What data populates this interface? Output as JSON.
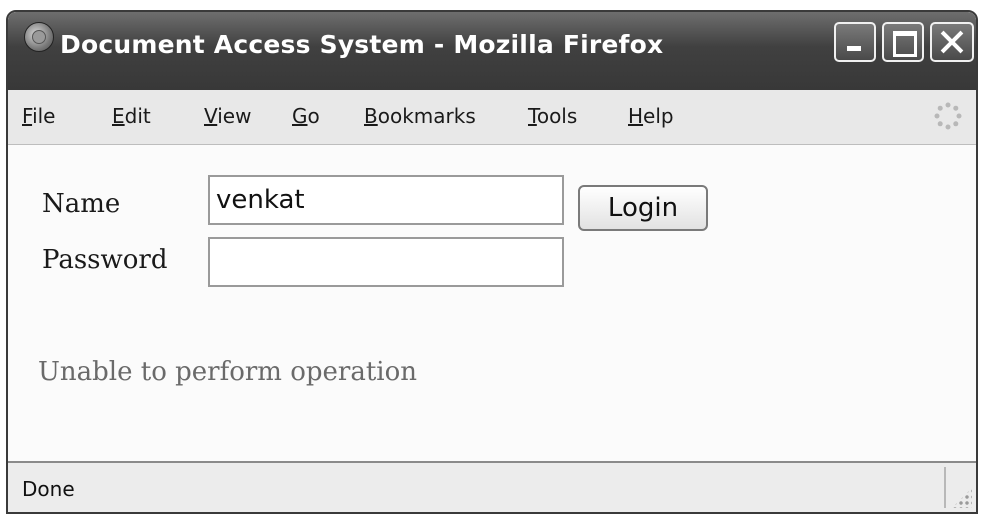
{
  "window": {
    "title": "Document Access System - Mozilla Firefox",
    "icon": "firefox-icon",
    "controls": [
      "minimize-icon",
      "maximize-icon",
      "close-icon"
    ]
  },
  "menu": {
    "items": [
      {
        "mnemonic": "F",
        "rest": "ile"
      },
      {
        "mnemonic": "E",
        "rest": "dit"
      },
      {
        "mnemonic": "V",
        "rest": "iew"
      },
      {
        "mnemonic": "G",
        "rest": "o"
      },
      {
        "mnemonic": "B",
        "rest": "ookmarks"
      },
      {
        "mnemonic": "T",
        "rest": "ools"
      },
      {
        "mnemonic": "H",
        "rest": "elp"
      }
    ],
    "throbber_icon": "throbber-icon"
  },
  "form": {
    "name_label": "Name",
    "name_value": "venkat",
    "password_label": "Password",
    "password_value": "",
    "login_label": "Login"
  },
  "message": "Unable to perform operation",
  "status": {
    "text": "Done"
  },
  "colors": {
    "titlebar": "#404040",
    "menubar": "#e8e8e8",
    "content_bg": "#fbfbfb",
    "message_text": "#6a6a6a"
  }
}
